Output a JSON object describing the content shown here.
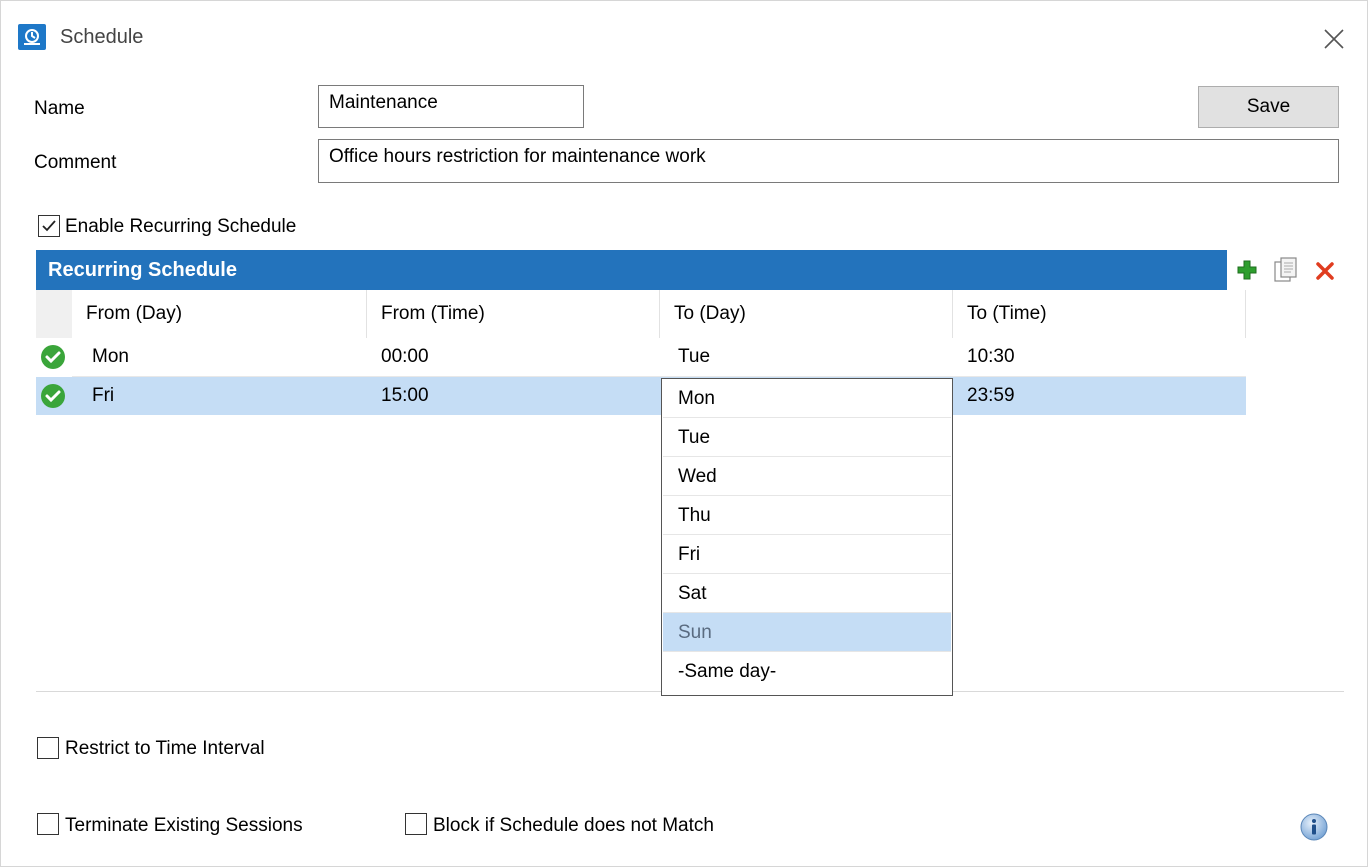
{
  "window": {
    "title": "Schedule"
  },
  "form": {
    "name_label": "Name",
    "name_value": "Maintenance",
    "comment_label": "Comment",
    "comment_value": "Office hours restriction for maintenance work",
    "save_label": "Save"
  },
  "recurring": {
    "enable_label": "Enable Recurring Schedule",
    "enable_checked": true,
    "grid_title": "Recurring Schedule",
    "columns": [
      "From (Day)",
      "From (Time)",
      "To (Day)",
      "To (Time)"
    ],
    "rows": [
      {
        "from_day": "Mon",
        "from_time": "00:00",
        "to_day": "Tue",
        "to_time": "10:30",
        "selected": false
      },
      {
        "from_day": "Fri",
        "from_time": "15:00",
        "to_day": "",
        "to_time": "23:59",
        "selected": true
      }
    ],
    "dropdown": {
      "options": [
        "Mon",
        "Tue",
        "Wed",
        "Thu",
        "Fri",
        "Sat",
        "Sun",
        "-Same day-"
      ],
      "highlighted": "Sun"
    },
    "toolbar": {
      "add_icon": "add-icon",
      "copy_icon": "copy-icon",
      "delete_icon": "delete-icon"
    }
  },
  "options": {
    "restrict_label": "Restrict to Time Interval",
    "terminate_label": "Terminate Existing Sessions",
    "block_label": "Block if Schedule does not Match"
  },
  "colors": {
    "accent": "#2373bc",
    "selection": "#c5ddf5",
    "ok_green": "#3aa53a",
    "delete_red": "#e03c1f",
    "add_green": "#2e9e2e"
  }
}
